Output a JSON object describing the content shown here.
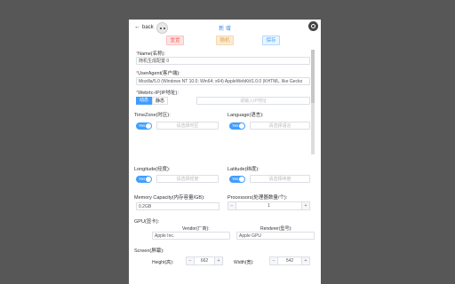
{
  "header": {
    "back_label": "back",
    "title": "新 增",
    "reset_label": "重置",
    "random_label": "随机",
    "save_label": "保存"
  },
  "form": {
    "name": {
      "label": "Name(名称):",
      "value": "随机生成配置 0"
    },
    "useragent": {
      "label": "UserAgent(客户端):",
      "value": "Mozilla/5.0 (Windows NT 10.0; Win64; x64) AppleWebKit/1.0.0 (KHTML, like Gecko"
    },
    "webrtc": {
      "label": "Webrtc-IP(IP地址):",
      "options": [
        "动态",
        "静态"
      ],
      "selected": "动态",
      "placeholder": "请输入IP地址"
    },
    "timezone": {
      "label": "TimeZone(时区):",
      "switch": "Yes",
      "placeholder": "请选择时区"
    },
    "language": {
      "label": "Language(语言):",
      "switch": "Yes",
      "placeholder": "请选择语言"
    },
    "longitude": {
      "label": "Longitude(经度):",
      "switch": "Yes",
      "placeholder": "请选择经度"
    },
    "latitude": {
      "label": "Latitude(纬度):",
      "switch": "Yes",
      "placeholder": "请选择纬度"
    },
    "memory": {
      "label": "Memory Capacity(内存容量/GB):",
      "value": "0.2GB"
    },
    "processors": {
      "label": "Processors(处理器数量/个):",
      "value": "1"
    },
    "gpu": {
      "label": "GPU(显卡):",
      "vendor_label": "Vendor(厂商):",
      "vendor_value": "Apple Inc.",
      "renderer_label": "Renderer(型号):",
      "renderer_value": "Apple GPU"
    },
    "screen": {
      "label": "Screen(屏幕):",
      "height_label": "Height(高):",
      "height_value": "662",
      "width_label": "Width(宽):",
      "width_value": "542"
    }
  }
}
